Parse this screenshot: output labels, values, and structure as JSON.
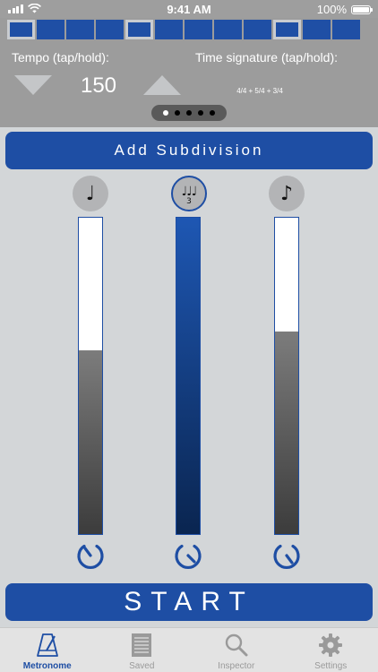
{
  "status_bar": {
    "time": "9:41 AM",
    "battery": "100%"
  },
  "header": {
    "beat_cells": [
      {
        "accent": true
      },
      {
        "accent": false
      },
      {
        "accent": false
      },
      {
        "accent": false
      },
      {
        "accent": true
      },
      {
        "accent": false
      },
      {
        "accent": false
      },
      {
        "accent": false
      },
      {
        "accent": false
      },
      {
        "accent": true
      },
      {
        "accent": false
      },
      {
        "accent": false
      }
    ],
    "tempo_label": "Tempo (tap/hold):",
    "tempo_value": "150",
    "timesig_label": "Time signature (tap/hold):",
    "timesig_value": "4/4 + 5/4 + 3/4",
    "pager": {
      "pages": 5,
      "active_index": 0
    }
  },
  "add_subdivision_label": "Add Subdivision",
  "subdivisions": [
    {
      "note": "♩",
      "note_icon": "quarter-note-icon",
      "level": 0.58,
      "selected": false,
      "color": "#6b6b6b"
    },
    {
      "note": "♩♩♩",
      "triplet_number": "3",
      "note_icon": "triplet-quarter-notes-icon",
      "level": 1.0,
      "selected": true,
      "color": "#1e4ea4"
    },
    {
      "note": "♪",
      "note_icon": "eighth-note-icon",
      "level": 0.64,
      "selected": false,
      "color": "#6b6b6b"
    }
  ],
  "start_label": "START",
  "tabs": [
    {
      "label": "Metronome",
      "icon": "metronome-icon",
      "active": true
    },
    {
      "label": "Saved",
      "icon": "saved-list-icon",
      "active": false
    },
    {
      "label": "Inspector",
      "icon": "magnifier-icon",
      "active": false
    },
    {
      "label": "Settings",
      "icon": "gear-icon",
      "active": false
    }
  ],
  "colors": {
    "accent": "#1e4ea4",
    "header_bg": "#9c9c9c",
    "body_bg": "#d3d6d8",
    "tab_bar_bg": "#e3e3e3"
  }
}
